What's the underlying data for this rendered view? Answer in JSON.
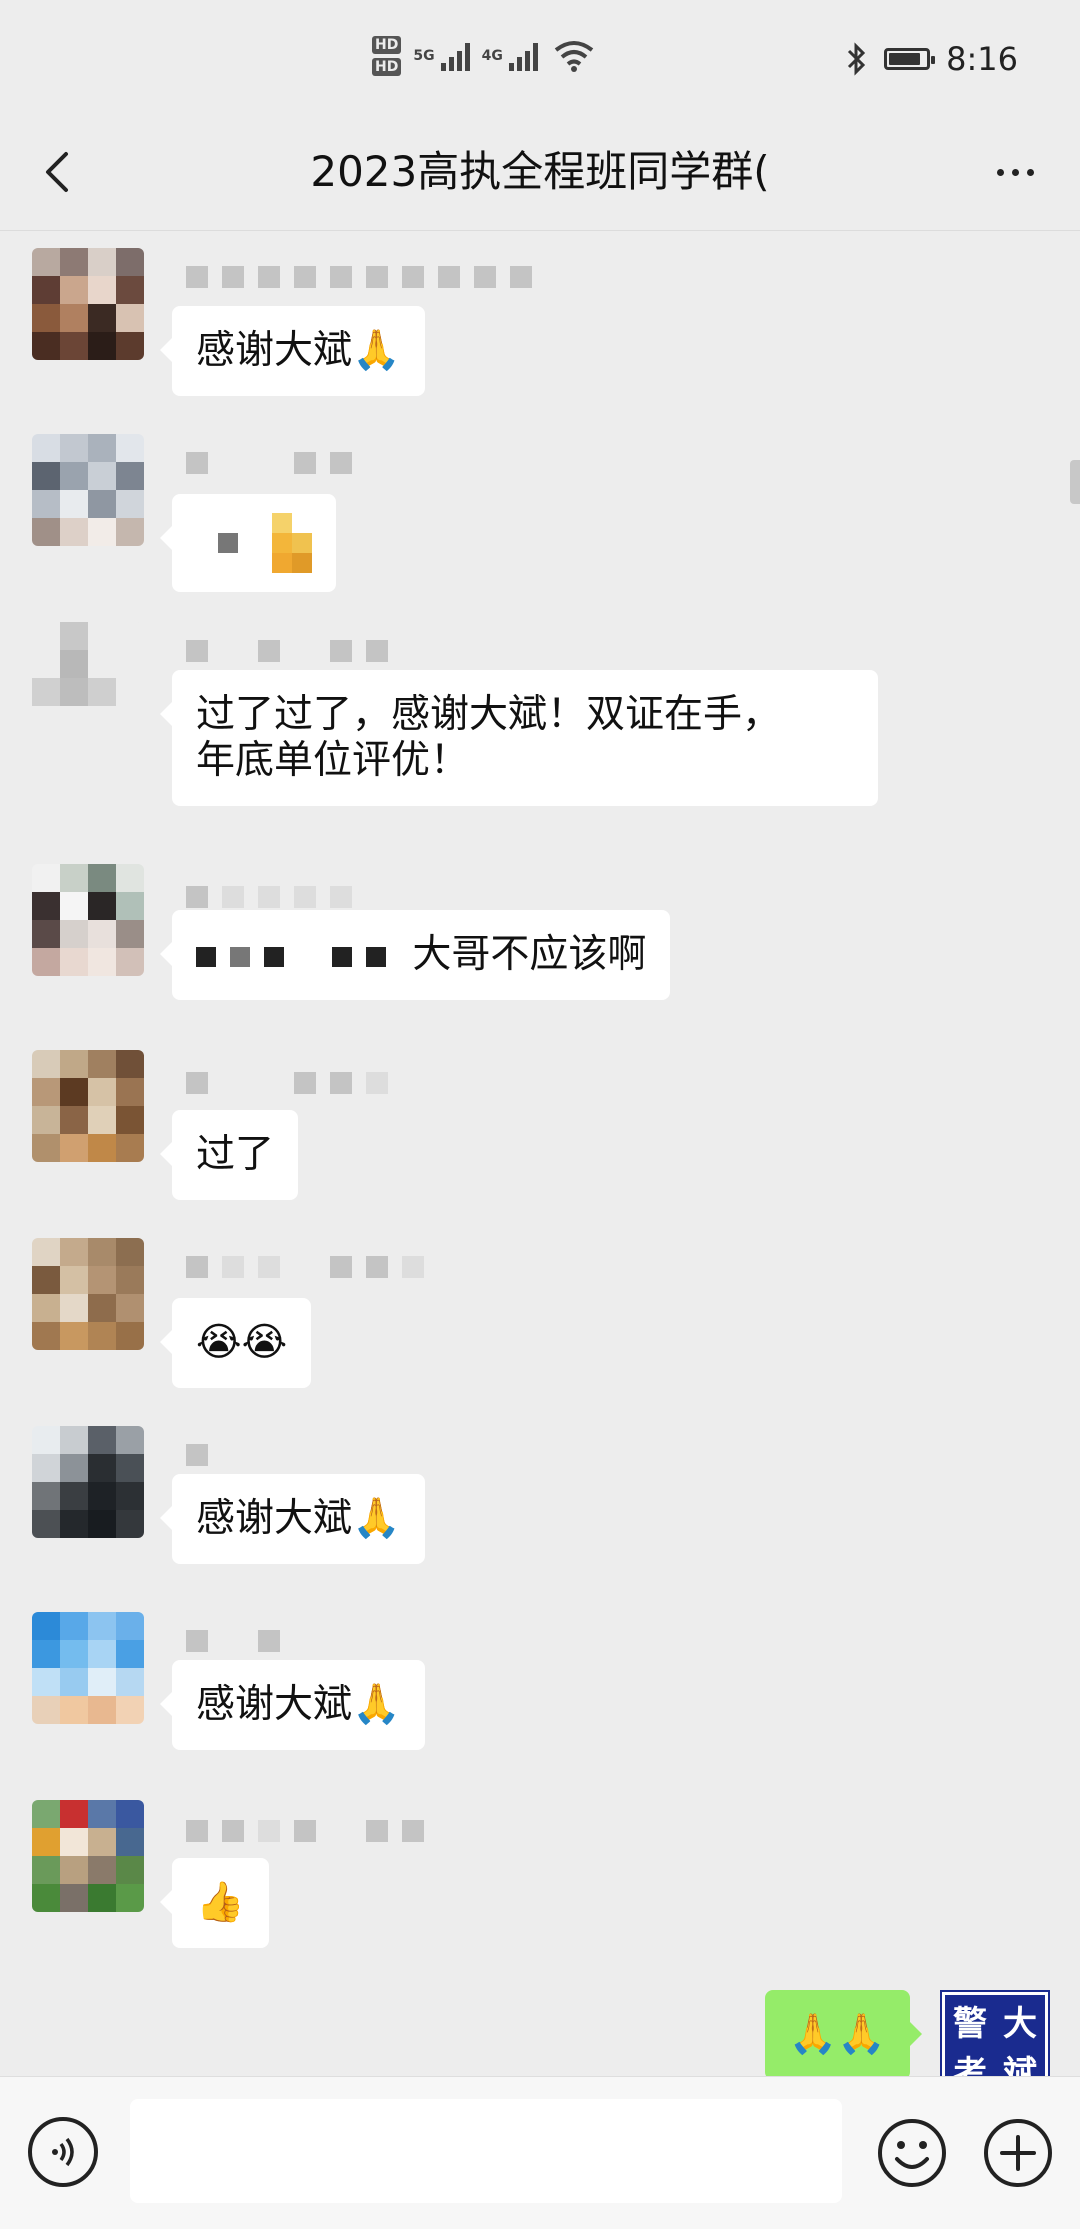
{
  "status_bar": {
    "hd1": "HD",
    "hd2": "HD",
    "net1": "5G",
    "net2": "4G",
    "time": "8:16",
    "battery_level": 0.85
  },
  "header": {
    "title": "2023高执全程班同学群(",
    "back_icon": "chevron-left-icon",
    "more_icon": "more-dots-icon"
  },
  "messages": [
    {
      "text": "感谢大斌",
      "emoji": "🙏"
    },
    {
      "text": "",
      "emoji": ""
    },
    {
      "text_line1": "过了过了，感谢大斌！双证在手，",
      "text_line2": "年底单位评优！"
    },
    {
      "text": "大哥不应该啊"
    },
    {
      "text": "过了"
    },
    {
      "emoji": "😭😭"
    },
    {
      "text": "感谢大斌",
      "emoji": "🙏"
    },
    {
      "text": "感谢大斌",
      "emoji": "🙏"
    },
    {
      "emoji": "👍"
    }
  ],
  "my_message": {
    "emoji": "🙏🙏",
    "avatar_chars": [
      "警",
      "大",
      "考",
      "斌"
    ]
  },
  "input_bar": {
    "placeholder": "",
    "voice_icon": "voice-icon",
    "emoji_icon": "emoji-icon",
    "plus_icon": "plus-icon"
  },
  "colors": {
    "background": "#ededed",
    "my_bubble": "#95ec69",
    "other_bubble": "#ffffff",
    "avatar_brand": "#1a2b8f"
  }
}
